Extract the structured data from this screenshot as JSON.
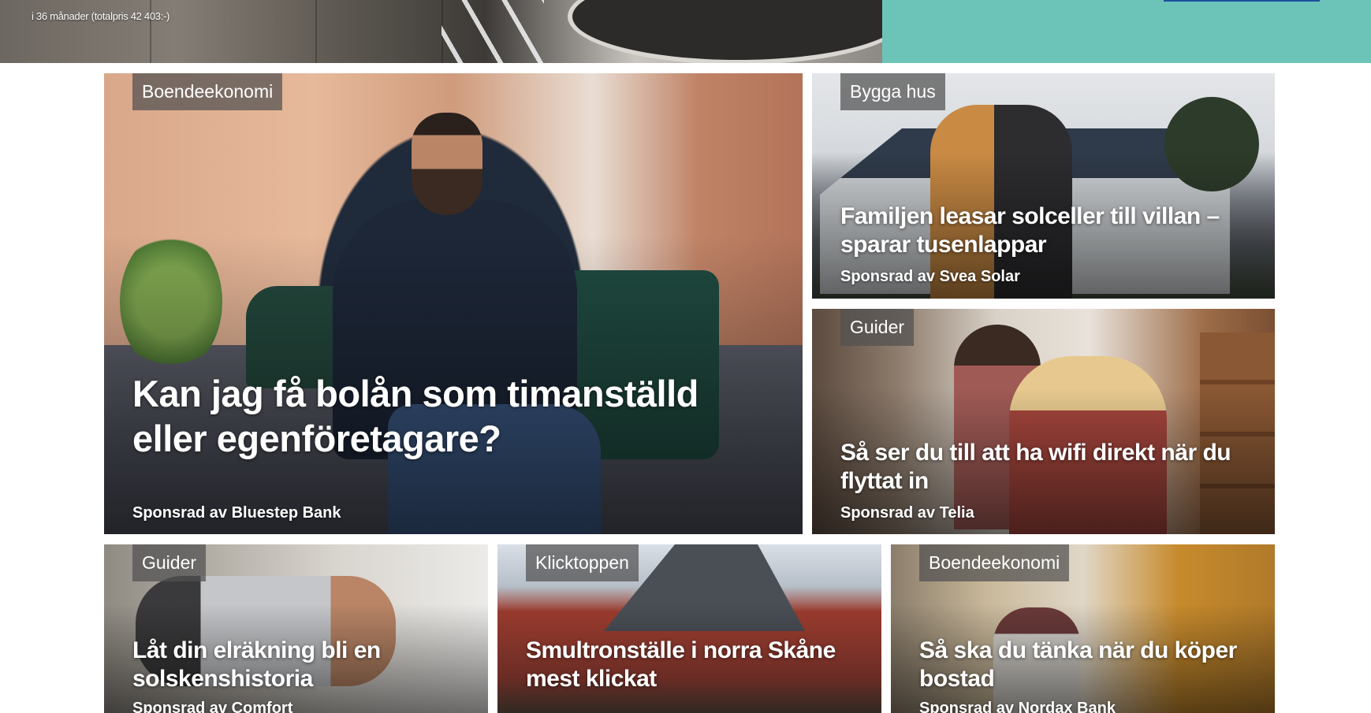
{
  "ad_banner": {
    "caption": "i 36 månader (totalpris 42 403:-)"
  },
  "colors": {
    "ad_teal": "#6cc4b8",
    "tag_background": "#5a5a5a",
    "ad_cta_blue": "#1d4f9c"
  },
  "cards": [
    {
      "category": "Boendeekonomi",
      "title": "Kan jag få bolån som timanställd eller egenföretagare?",
      "sponsor": "Sponsrad av Bluestep Bank"
    },
    {
      "category": "Bygga hus",
      "title": "Familjen leasar solceller till villan – sparar tusenlappar",
      "sponsor": "Sponsrad av Svea Solar"
    },
    {
      "category": "Guider",
      "title": "Så ser du till att ha wifi direkt när du flyttat in",
      "sponsor": "Sponsrad av Telia"
    },
    {
      "category": "Guider",
      "title": "Låt din elräkning bli en solskenshistoria",
      "sponsor": "Sponsrad av Comfort"
    },
    {
      "category": "Klicktoppen",
      "title": "Smultronställe i norra Skåne mest klickat",
      "sponsor": ""
    },
    {
      "category": "Boendeekonomi",
      "title": "Så ska du tänka när du köper bostad",
      "sponsor": "Sponsrad av Nordax Bank"
    }
  ]
}
